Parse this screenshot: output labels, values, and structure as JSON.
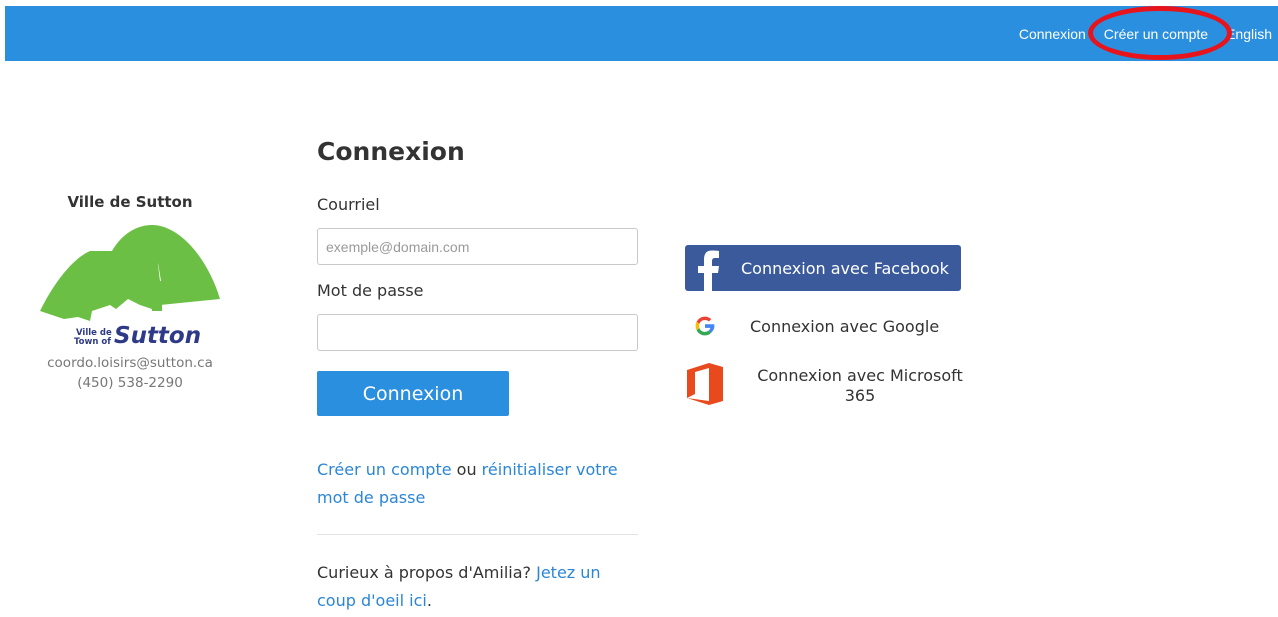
{
  "topnav": {
    "login": "Connexion",
    "create_account": "Créer un compte",
    "language": "English"
  },
  "org": {
    "name": "Ville de Sutton",
    "logo_text_small_1": "Ville de",
    "logo_text_small_2": "Town of",
    "logo_text_large": "Sutton",
    "email": "coordo.loisirs@sutton.ca",
    "phone": "(450) 538-2290"
  },
  "form": {
    "title": "Connexion",
    "email_label": "Courriel",
    "email_placeholder": "exemple@domain.com",
    "email_value": "",
    "password_label": "Mot de passe",
    "password_value": "",
    "submit_label": "Connexion",
    "create_account_link": "Créer un compte",
    "or_text": " ou ",
    "reset_link": "réinitialiser votre mot de passe",
    "promo_text": "Curieux à propos d'Amilia? ",
    "promo_link": "Jetez un coup d'oeil ici",
    "promo_end": "."
  },
  "social": {
    "facebook_label": "Connexion avec Facebook",
    "google_label": "Connexion avec Google",
    "microsoft_label": "Connexion avec Microsoft 365",
    "facebook_icon": "facebook-icon",
    "google_icon": "google-icon",
    "microsoft_icon": "office-icon"
  },
  "colors": {
    "topbar": "#2b8fe0",
    "primary_button": "#2b8fe0",
    "link": "#2b86d6",
    "facebook": "#3b5a9b",
    "logo_green": "#6cbf45",
    "logo_navy": "#2e3a87",
    "annotation_red": "#e8141c"
  }
}
